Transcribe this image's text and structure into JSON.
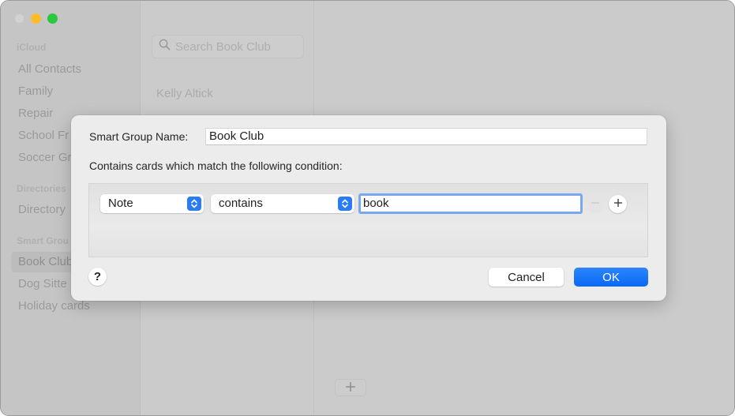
{
  "window": {
    "traffic_lights": [
      "close",
      "minimize",
      "zoom"
    ]
  },
  "sidebar": {
    "sections": [
      {
        "label": "iCloud",
        "items": [
          "All Contacts",
          "Family",
          "Repair",
          "School Fr",
          "Soccer Gr"
        ]
      },
      {
        "label": "Directories",
        "items": [
          "Directory"
        ]
      },
      {
        "label": "Smart Grou",
        "items": [
          "Book Club",
          "Dog Sitte",
          "Holiday cards"
        ]
      }
    ],
    "selected_item": "Book Club"
  },
  "list": {
    "search_placeholder": "Search Book Club",
    "contacts": [
      "Kelly Altick"
    ]
  },
  "detail": {
    "add_button_icon": "plus-icon"
  },
  "dialog": {
    "name_label": "Smart Group Name:",
    "name_value": "Book Club",
    "condition_label": "Contains cards which match the following condition:",
    "condition": {
      "field": "Note",
      "operator": "contains",
      "value": "book"
    },
    "help_label": "?",
    "cancel_label": "Cancel",
    "ok_label": "OK"
  },
  "colors": {
    "accent": "#0a68f5",
    "focus_ring": "#7aa8ee",
    "minimize": "#fdbc2e",
    "maximize": "#2ac840"
  }
}
